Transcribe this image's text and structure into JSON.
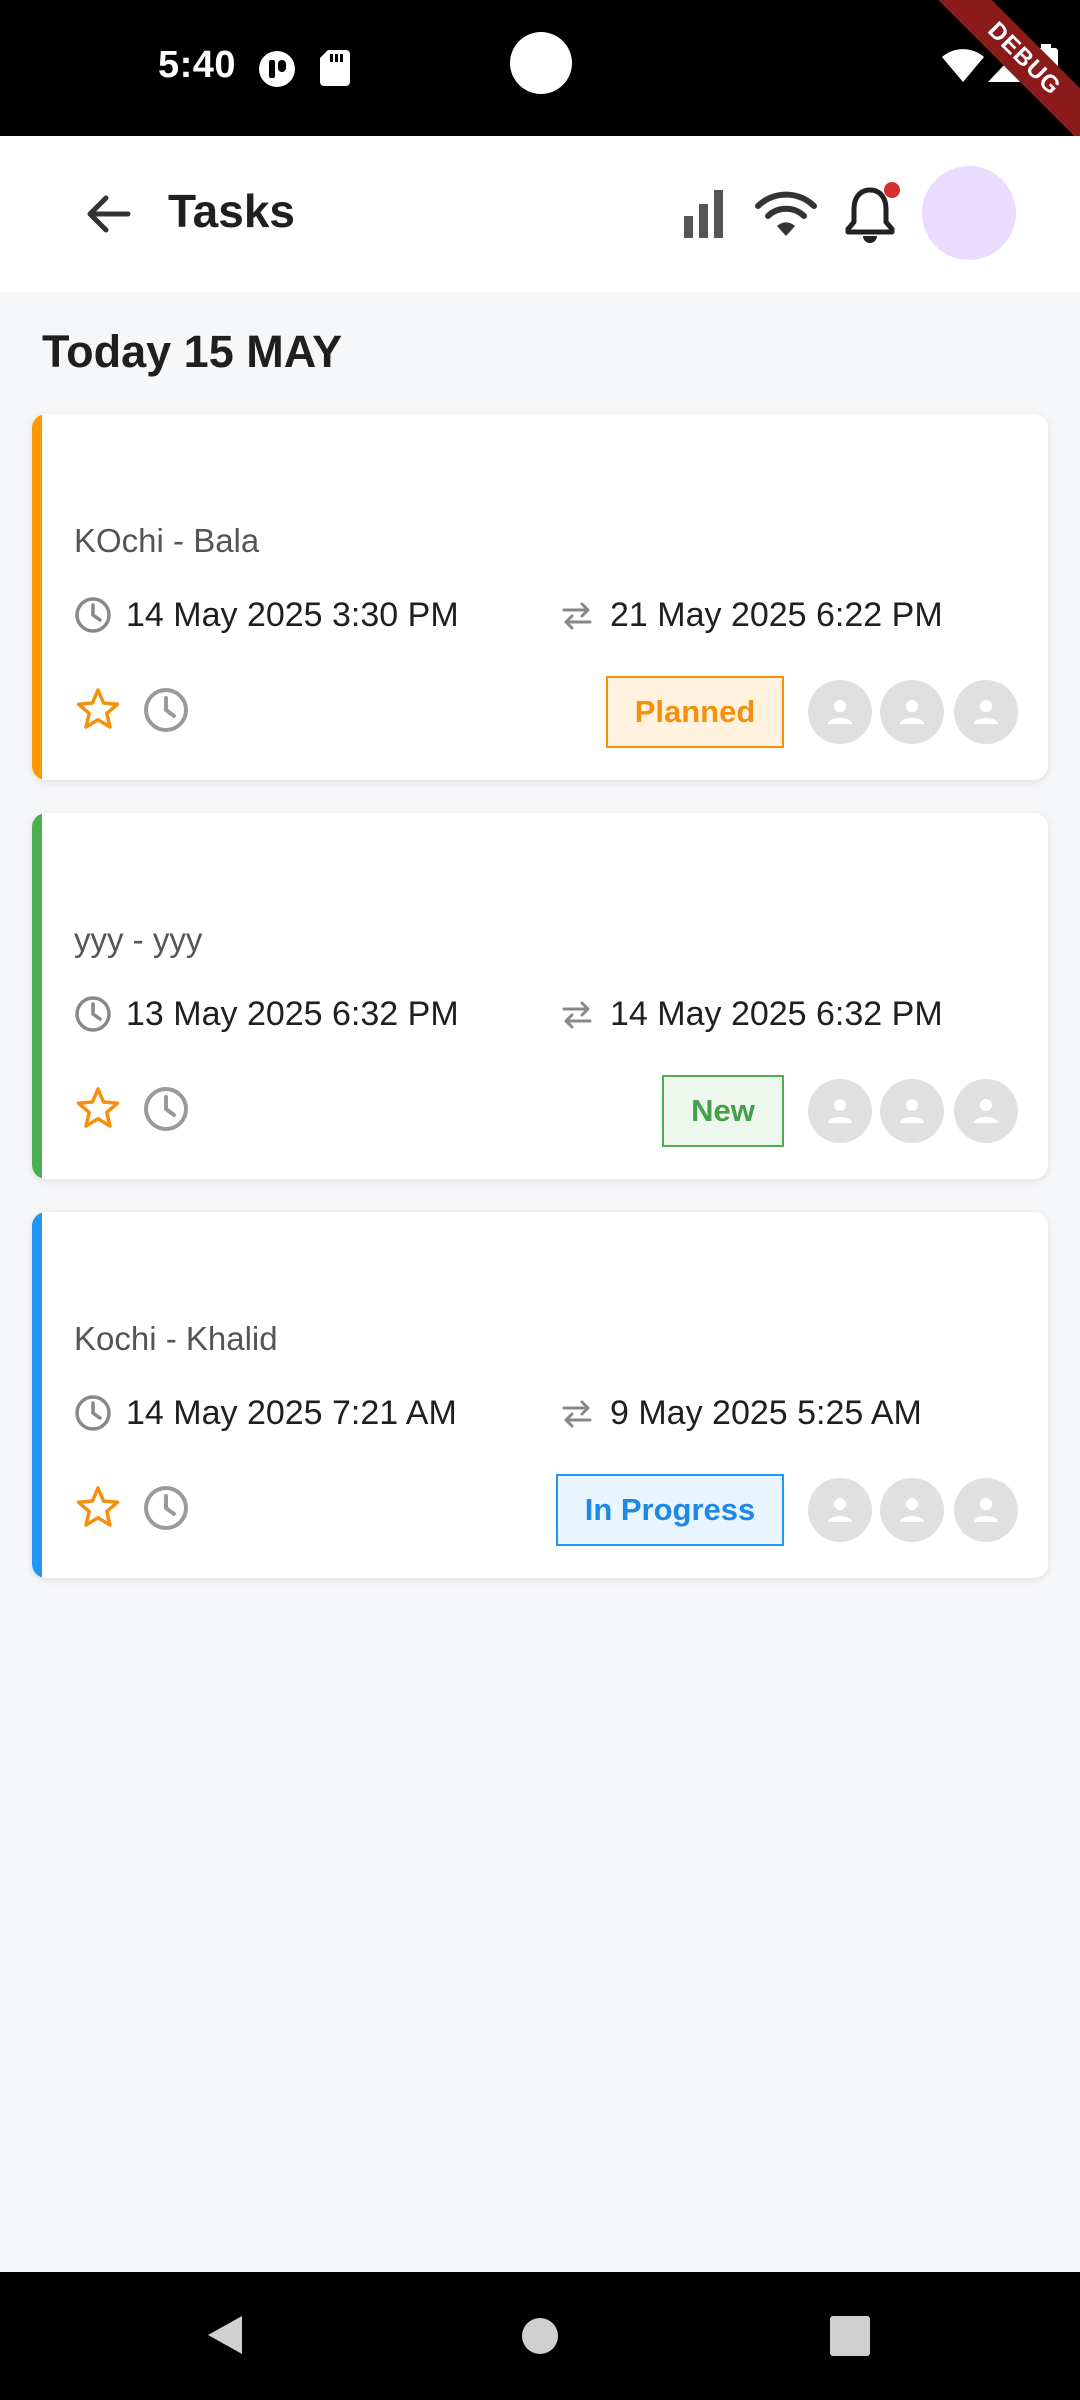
{
  "status_bar": {
    "time": "5:40",
    "debug_label": "DEBUG"
  },
  "app_bar": {
    "title": "Tasks",
    "avatar_color": "#EADCFF",
    "notification_dot_color": "#D32F2F"
  },
  "section": {
    "title": "Today 15 MAY"
  },
  "tasks": [
    {
      "title": "KOchi - Bala",
      "start": "14 May 2025 3:30 PM",
      "end": "21 May 2025 6:22 PM",
      "status": "Planned",
      "accent": "#FF9800",
      "badge_bg": "#FFF3E0",
      "badge_text_color": "#F4900C",
      "badge_border": "#F4900C"
    },
    {
      "title": "yyy - yyy",
      "start": "13 May 2025 6:32 PM",
      "end": "14 May 2025 6:32 PM",
      "status": "New",
      "accent": "#4CAF50",
      "badge_bg": "#EDF7EE",
      "badge_text_color": "#43A047",
      "badge_border": "#4CAF50"
    },
    {
      "title": "Kochi - Khalid",
      "start": "14 May 2025 7:21 AM",
      "end": "9 May 2025 5:25 AM",
      "status": "In Progress",
      "accent": "#2196F3",
      "badge_bg": "#E8F4FE",
      "badge_text_color": "#1E88E5",
      "badge_border": "#2196F3"
    }
  ],
  "icons": {
    "back": "arrow-back-icon",
    "signal": "signal-bars-icon",
    "wifi": "wifi-icon",
    "bell": "bell-icon",
    "clock": "clock-icon",
    "swap": "swap-arrows-icon",
    "star": "star-outline-icon",
    "person": "person-icon"
  }
}
